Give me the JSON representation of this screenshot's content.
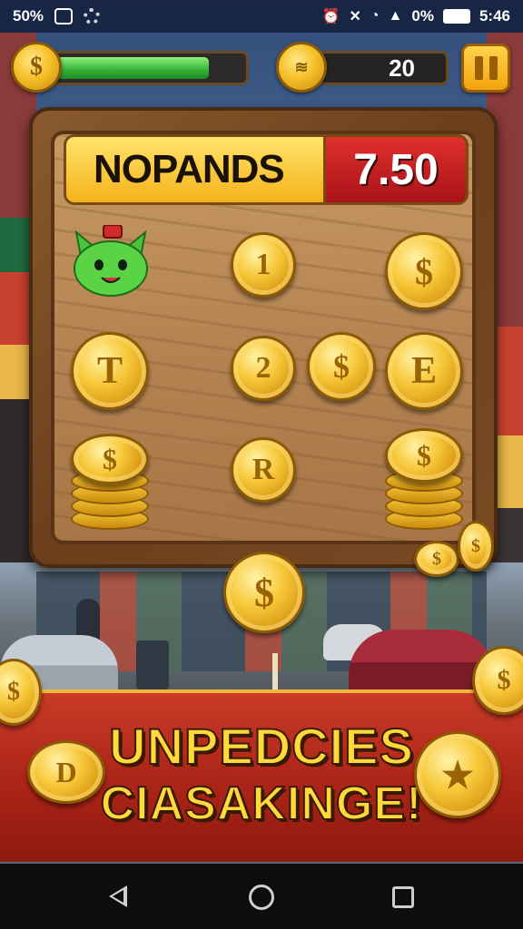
{
  "status_bar": {
    "battery_left": "50%",
    "battery_right": "0%",
    "time": "5:46",
    "icons": [
      "image-icon",
      "settings-icon",
      "alarm-icon",
      "mute-icon",
      "wifi-icon",
      "signal-icon",
      "battery-icon"
    ]
  },
  "hud": {
    "coin_icon": "dollar-coin-icon",
    "progress": 0.82,
    "coin_count": "20",
    "pause_icon": "pause-icon"
  },
  "board": {
    "title": "NOPANDS",
    "score": "7.50"
  },
  "coins": {
    "c1": "1",
    "c2": "$",
    "c3": "T",
    "c4": "2",
    "c5": "$",
    "c6": "E",
    "c7": "R",
    "stack1": "$",
    "stack2": "$",
    "drop": "$",
    "loose1": "$",
    "loose2": "$"
  },
  "banner": {
    "line1": "UNPEDCIES",
    "line2": "CIASAKINGE!"
  },
  "decor": {
    "left_coin": "$",
    "left_stack": "D",
    "right_coin": "★",
    "right_coin_small": "$"
  },
  "colors": {
    "gold": "#f6c12a",
    "progress_green": "#35b238",
    "score_red": "#c8201f",
    "banner_red": "#b82a1a"
  }
}
